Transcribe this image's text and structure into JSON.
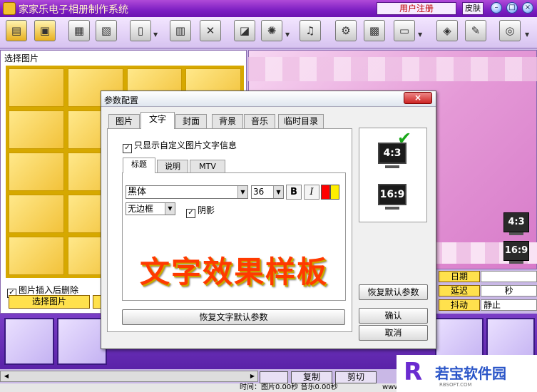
{
  "app": {
    "title": "家家乐电子相册制作系统",
    "register_label": "用户注册",
    "skin_label": "皮肤",
    "minimize_glyph": "–",
    "restore_glyph": "□",
    "close_glyph": "×"
  },
  "left_panel": {
    "title": "选择图片",
    "delete_after_insert_label": "图片插入后删除",
    "delete_after_insert_checked": true,
    "select_button_label": "选择图片"
  },
  "right_panel": {
    "ratio_43": "4:3",
    "ratio_169": "16:9",
    "rows": [
      {
        "label": "日期",
        "value": ""
      },
      {
        "label": "延迟",
        "value": "秒"
      },
      {
        "label": "抖动",
        "value": "静止"
      }
    ]
  },
  "bottom": {
    "copy_label": "复制",
    "cut_label": "剪切",
    "status_text": "时间：图片0.00秒 音乐0.00秒",
    "status_tail": "www"
  },
  "dialog": {
    "title": "参数配置",
    "close_glyph": "×",
    "tabs": [
      "图片",
      "文字",
      "封面",
      "背景",
      "音乐",
      "临时目录"
    ],
    "active_tab": "文字",
    "custom_text_only_label": "只显示自定义图片文字信息",
    "custom_text_only_checked": true,
    "subtabs": [
      "标题",
      "说明",
      "MTV"
    ],
    "active_subtab": "标题",
    "font_value": "黑体",
    "size_value": "36",
    "bold_label": "B",
    "italic_label": "I",
    "color_primary": "#ff0000",
    "color_secondary": "#ffee00",
    "border_value": "无边框",
    "shadow_label": "阴影",
    "shadow_checked": true,
    "sample_text": "文字效果样板",
    "restore_text_defaults_label": "恢复文字默认参数",
    "ratio_43": "4:3",
    "ratio_169": "16:9",
    "selected_ratio": "4:3",
    "restore_defaults_label": "恢复默认参数",
    "ok_label": "确认",
    "cancel_label": "取消"
  },
  "watermark": {
    "logo_glyph": "R",
    "text": "若宝软件园",
    "sub": "RBSOFT.COM"
  }
}
